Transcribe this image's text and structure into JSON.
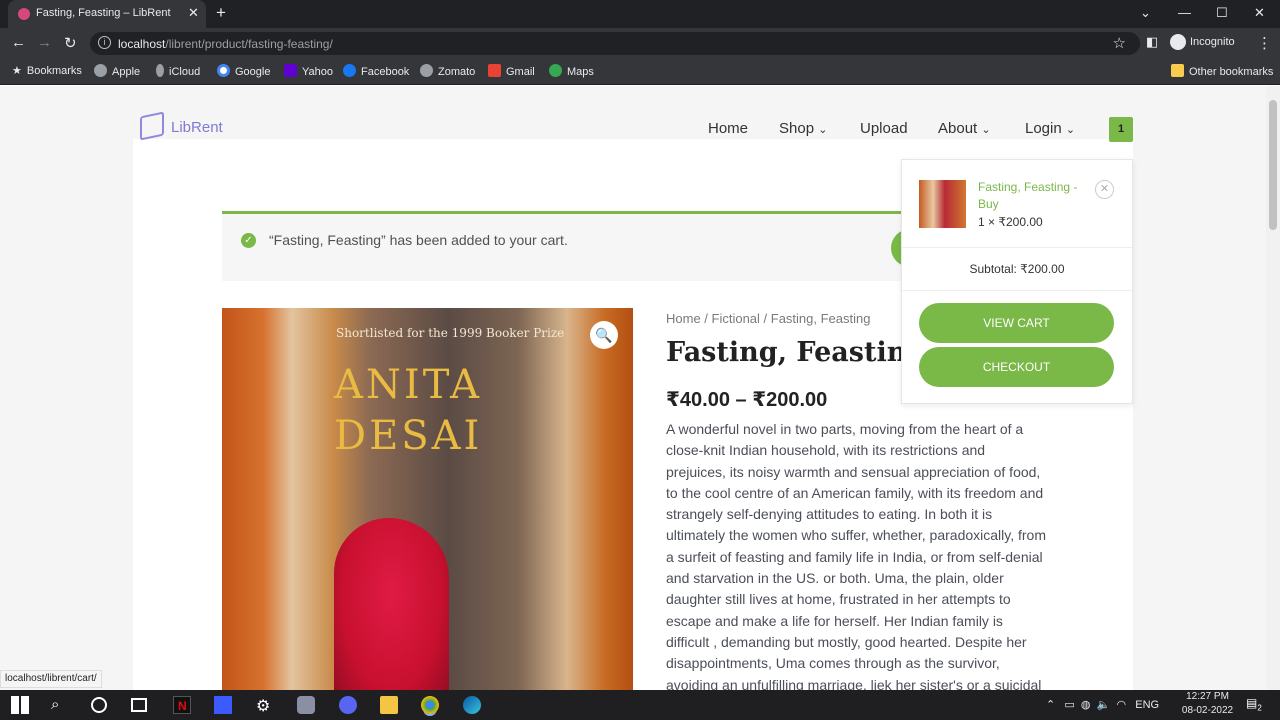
{
  "browser": {
    "tab_title": "Fasting, Feasting – LibRent",
    "url_host": "localhost",
    "url_path": "/librent/product/fasting-feasting/",
    "incognito_label": "Incognito",
    "bookmarks": [
      "Bookmarks",
      "Apple",
      "iCloud",
      "Google",
      "Yahoo",
      "Facebook",
      "Zomato",
      "Gmail",
      "Maps"
    ],
    "other_bookmarks": "Other bookmarks",
    "status_url": "localhost/librent/cart/"
  },
  "site": {
    "logo": "LibRent",
    "nav": {
      "home": "Home",
      "shop": "Shop",
      "upload": "Upload",
      "about": "About",
      "login": "Login"
    },
    "cart_count": "1",
    "accent": "#7ab848"
  },
  "notice": {
    "message": "“Fasting, Feasting” has been added to your cart."
  },
  "product": {
    "breadcrumb": "Home / Fictional / Fasting, Feasting",
    "title": "Fasting, Feasting",
    "price": "₹40.00 – ₹200.00",
    "description": "A wonderful novel in two parts, moving from the heart of a close-knit Indian household, with its restrictions and prejuices, its noisy warmth and sensual appreciation of food, to the cool centre of an American family, with its freedom and strangely self-denying attitudes to eating. In both it is ultimately the women who suffer, whether, paradoxically, from a surfeit of feasting and family life in India, or from self-denial and starvation in the US. or both. Uma, the plain, older daughter still lives at home, frustrated in her attempts to escape and make a life for herself. Her Indian family is difficult , demanding but mostly, good hearted. Despite her disappointments, Uma comes through as the survivor, avoiding an unfulfilling marriage, liek her sister's or a suicidal",
    "cover": {
      "shortlist": "Shortlisted for the 1999 Booker Prize",
      "author_line1": "ANITA",
      "author_line2": "DESAI"
    }
  },
  "minicart": {
    "item_name": "Fasting, Feasting - Buy",
    "item_qty": "1 × ₹200.00",
    "subtotal": "Subtotal: ₹200.00",
    "view_cart": "VIEW CART",
    "checkout": "CHECKOUT"
  },
  "taskbar": {
    "lang": "ENG",
    "time": "12:27 PM",
    "date": "08-02-2022",
    "notifications": "2"
  }
}
